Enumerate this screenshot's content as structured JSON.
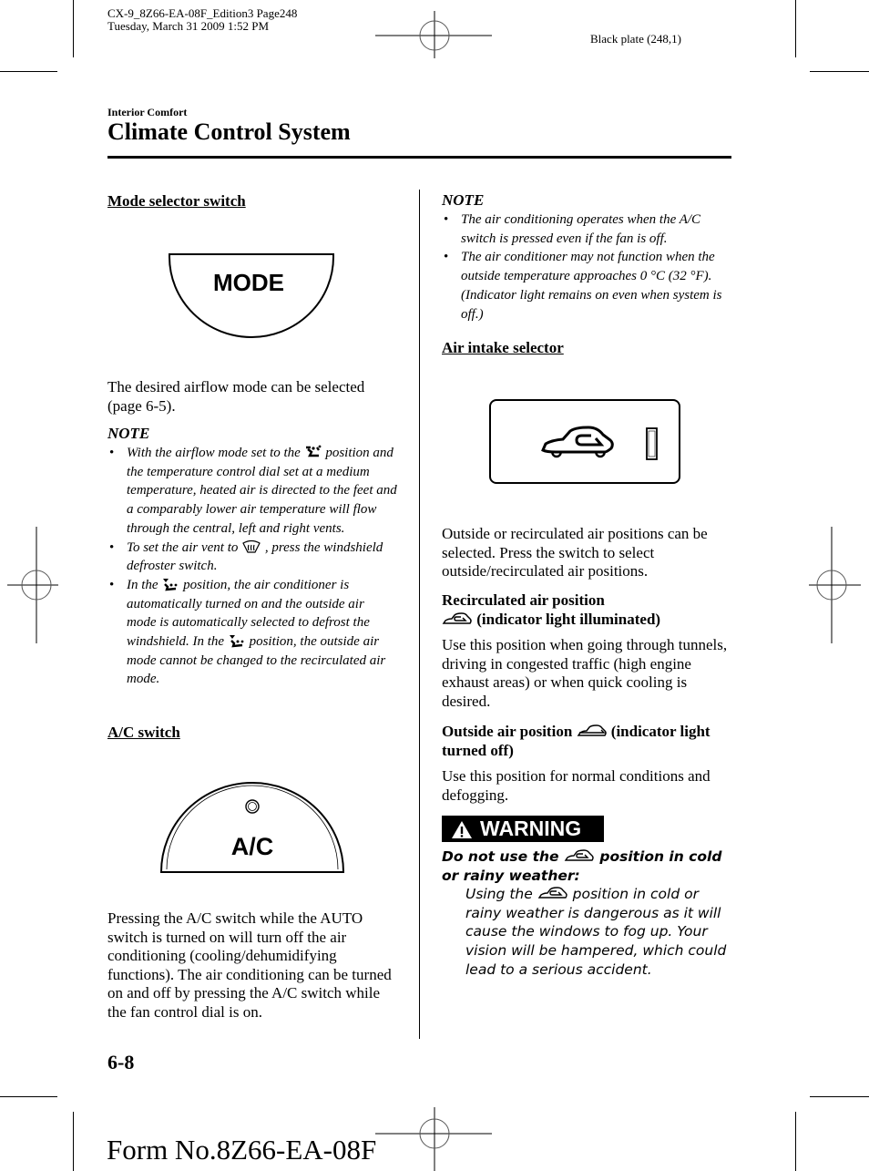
{
  "print_header": {
    "job_line": "CX-9_8Z66-EA-08F_Edition3 Page248",
    "date_line": "Tuesday, March 31 2009 1:52 PM",
    "plate": "Black plate (248,1)"
  },
  "section_label": "Interior Comfort",
  "page_title": "Climate Control System",
  "left_column": {
    "mode_heading": "Mode selector switch",
    "mode_button_label": "MODE",
    "mode_body": "The desired airflow mode can be selected (page 6-5).",
    "note_title": "NOTE",
    "notes": [
      {
        "before": "With the airflow mode set to the",
        "icon": "floor-vent-icon",
        "after": "position and the temperature control dial set at a medium temperature, heated air is directed to the feet and a comparably lower air temperature will flow through the central, left and right vents."
      },
      {
        "before": "To set the air vent to",
        "icon": "defroster-icon",
        "after": ", press the windshield defroster switch."
      },
      {
        "before": "In the",
        "icon": "floor-defrost-icon",
        "middle": "position, the air conditioner is automatically turned on and the outside air mode is automatically selected to defrost the windshield. In the",
        "icon2": "floor-defrost-icon",
        "after": "position, the outside air mode cannot be changed to the recirculated air mode."
      }
    ],
    "ac_heading": "A/C switch",
    "ac_button_label": "A/C",
    "ac_body": "Pressing the A/C switch while the AUTO switch is turned on will turn off the air conditioning (cooling/dehumidifying functions). The air conditioning can be turned on and off by pressing the A/C switch while the fan control dial is on."
  },
  "right_column": {
    "note_title": "NOTE",
    "notes": [
      "The air conditioning operates when the A/C switch is pressed even if the fan is off.",
      "The air conditioner may not function when the outside temperature approaches 0 °C (32 °F). (Indicator light remains on even when system is off.)"
    ],
    "intake_heading": "Air intake selector",
    "intake_body": "Outside or recirculated air positions can be selected. Press the switch to select outside/recirculated air positions.",
    "recirc_heading_1": "Recirculated air position",
    "recirc_heading_2": "(indicator light illuminated)",
    "recirc_body": "Use this position when going through tunnels, driving in congested traffic (high engine exhaust areas) or when quick cooling is desired.",
    "outside_heading_1": "Outside air position",
    "outside_heading_2": "(indicator light turned off)",
    "outside_body": "Use this position for normal conditions and defogging.",
    "warning_label": "WARNING",
    "warning_lead_1": "Do not use the",
    "warning_lead_2": "position in cold or rainy weather:",
    "warning_detail_1": "Using the",
    "warning_detail_2": "position in cold or rainy weather is dangerous as it will cause the windows to fog up. Your vision will be hampered, which could lead to a serious accident."
  },
  "page_number": "6-8",
  "form_number": "Form No.8Z66-EA-08F"
}
